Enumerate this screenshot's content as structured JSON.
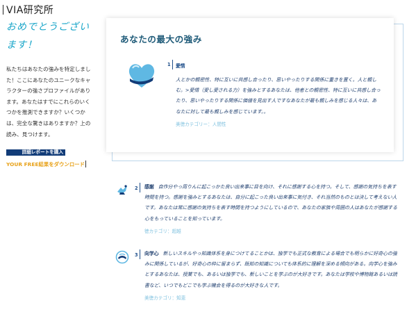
{
  "header": {
    "title": "VIA研究所"
  },
  "left": {
    "congrats": "おめでとうございます！",
    "intro": "私たちはあなたの強みを特定しました！ここにあなたのユニークなキャラクターの強さプロファイルがあります。あなたはすでにこれらのいくつかを推測できますか？いくつかは、完全な驚きはありますか？上の読み、見つけます。",
    "report_button": "詳細レポートを購入",
    "download_link": "YOUR FREE結果をダウンロード"
  },
  "card": {
    "title": "あなたの最大の強み"
  },
  "strengths": [
    {
      "rank": "1",
      "name": "愛情",
      "description": "人とかの親密性、特に互いに共感し合ったり、思いやったりする関係に重きを置く。人と親しむ。>愛情（愛し愛される力）を強みとするあなたは、他者との親密性、特に互いに共感し合ったり、思いやったりする関係に価値を見出す人ですなあなたが最も親しみを感じる人々は、あなたに対して最も親しみを感じています。。",
      "category": "美徳カテゴリー：人間性"
    },
    {
      "rank": "2",
      "name": "感謝",
      "description": "自作分やっ周りんに起こっかた良い出来事に目を向け、それに感謝する心を持つ。そして、感謝の気持ちを表す時間を持つ。感謝を強みとするあなたは、自分に起こった良い出来事に気付き、それ当然のものとは決して考えない人です。あなたは常に感謝の気持ちを表す時間を持つようにしているので、あなたの家族や周囲の人はあなたが感謝する心をもっていることを知っています。",
      "category": "徳カテゴリ：超越"
    },
    {
      "rank": "3",
      "name": "向学心",
      "description": "新しいスキルやっ知識体系を身につけてることかは、独学でも正式な教育による場合でも明らかに好奇心の強みに関係しているが、好奇心の枠に留まらず、既知の知識についても体系的に理解を深める傾向がある。向学心を強みとするあなたは、授業でも、あるいは独学でも、新しいことを学ぶのが大好きです。あなたは学校や博物館あるいは読書など、いつでもどこでも学ぶ機会を得るのが大好きな人です。",
      "category": "美徳カテゴリ：知恵"
    }
  ],
  "colors": {
    "accent": "#1aa6c9",
    "navy": "#123c78",
    "orange": "#e8a21a",
    "category": "#7fc1df"
  },
  "icons": [
    "heart-icon",
    "grateful-bird-icon",
    "learning-globe-icon"
  ]
}
